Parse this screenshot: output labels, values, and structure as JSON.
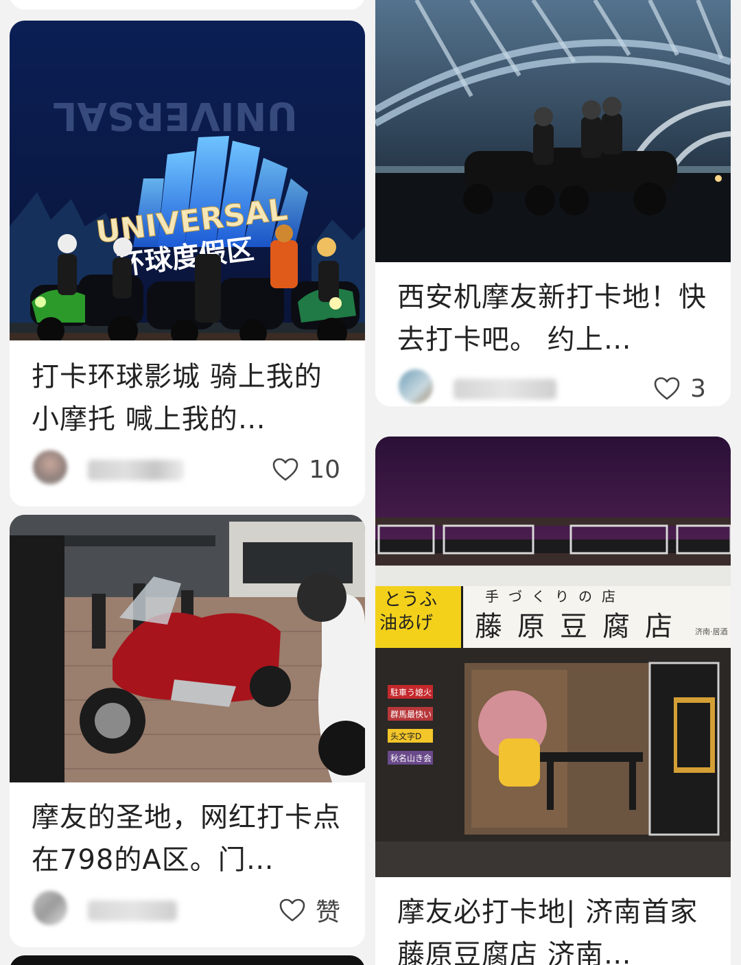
{
  "feed": {
    "cards": [
      {
        "title": "打卡环球影城 骑上我的小摩托 喊上我的…",
        "like_label": "10",
        "photo": {
          "sign_text": "UNIVERSAL",
          "sign_subtext": "环球度假区",
          "sign_mirror_text": "UNIVERSAL"
        }
      },
      {
        "title": "西安机摩友新打卡地！快去打卡吧。 约上…",
        "like_label": "3"
      },
      {
        "title": "摩友的圣地，网红打卡点在798的A区。门…",
        "like_label": "赞"
      },
      {
        "title": "摩友必打卡地| 济南首家藤原豆腐店 济南…",
        "photo": {
          "side_sign_line1": "とうふ",
          "side_sign_line2": "油あげ",
          "sign_small": "手づくりの店",
          "sign_main": "藤原豆腐店",
          "sign_tag": "济南·居酒",
          "door_labels": [
            "駐車う媳火",
            "群馬最快い",
            "头文字D",
            "秋名山き会"
          ]
        }
      }
    ]
  },
  "colors": {
    "background": "#f2f2f2",
    "card": "#ffffff",
    "title_text": "#222222",
    "like_text": "#444444"
  },
  "icons": {
    "like": "heart-outline-icon"
  }
}
